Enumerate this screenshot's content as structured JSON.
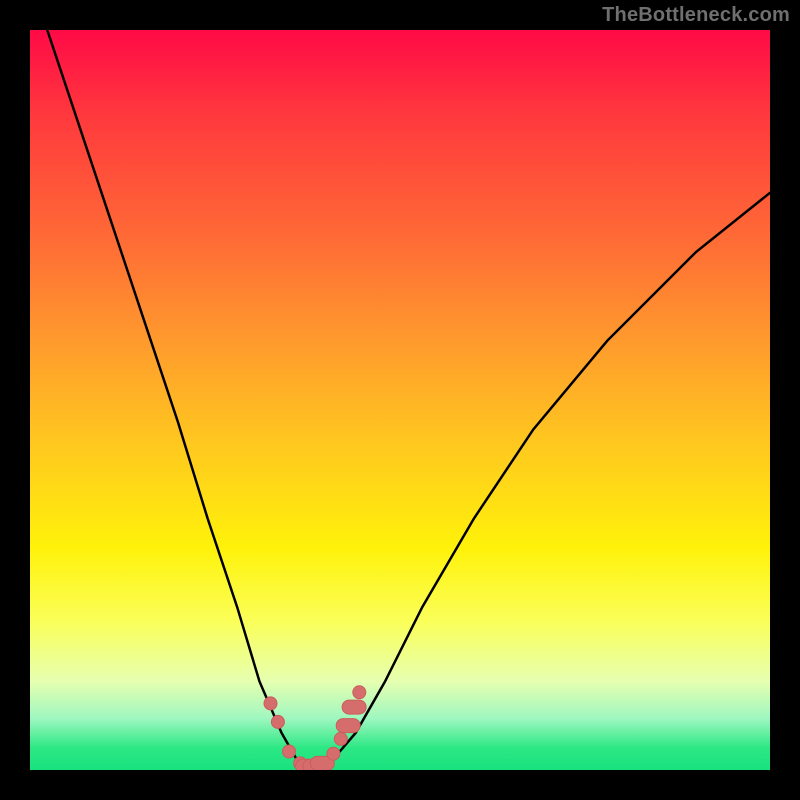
{
  "watermark": "TheBottleneck.com",
  "colors": {
    "frame_bg": "#000000",
    "curve_stroke": "#000000",
    "marker_fill": "#d66d6d",
    "marker_stroke": "#cc5c5c",
    "gradient_top": "#ff0a46",
    "gradient_bottom": "#18e27f",
    "watermark": "#6f6f6f"
  },
  "chart_data": {
    "type": "line",
    "title": "",
    "xlabel": "",
    "ylabel": "",
    "xlim": [
      0,
      100
    ],
    "ylim": [
      0,
      100
    ],
    "grid": false,
    "legend": false,
    "note": "V-shaped bottleneck curve over a red→green vertical gradient. Lower y is better (green). Values estimated from pixel positions; no axis ticks are shown.",
    "series": [
      {
        "name": "bottleneck-curve",
        "x": [
          0,
          5,
          10,
          15,
          20,
          24,
          28,
          31,
          34,
          36,
          37.5,
          39,
          41,
          44,
          48,
          53,
          60,
          68,
          78,
          90,
          100
        ],
        "y": [
          107,
          92,
          77,
          62,
          47,
          34,
          22,
          12,
          5,
          1.5,
          0.5,
          0.5,
          1.5,
          5,
          12,
          22,
          34,
          46,
          58,
          70,
          78
        ]
      }
    ],
    "markers": {
      "name": "highlighted-points",
      "shape": "rounded-rect",
      "pill_indices": [
        4,
        5,
        6,
        9,
        10
      ],
      "x": [
        32.5,
        33.5,
        35,
        36.5,
        37.5,
        38.5,
        39.5,
        41,
        42,
        43,
        43.8,
        44.5
      ],
      "y": [
        9,
        6.5,
        2.5,
        0.9,
        0.5,
        0.5,
        0.9,
        2.2,
        4.2,
        6,
        8.5,
        10.5
      ]
    }
  }
}
